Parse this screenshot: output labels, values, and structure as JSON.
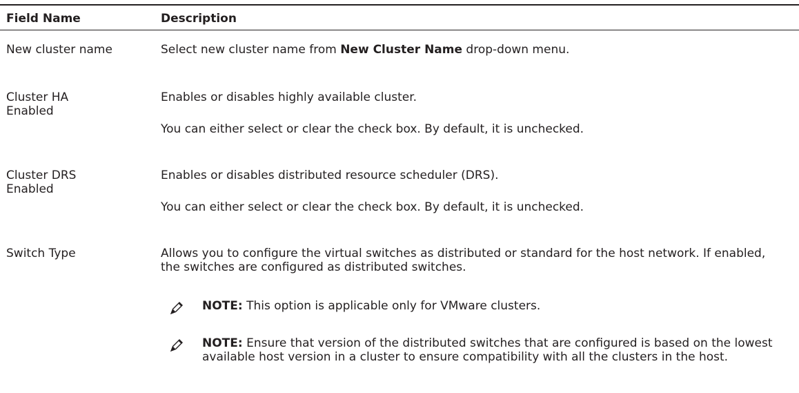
{
  "header": {
    "field_name": "Field Name",
    "description": "Description"
  },
  "rows": [
    {
      "field": "New cluster name",
      "desc_pre": "Select new cluster name from ",
      "desc_bold": "New Cluster Name",
      "desc_post": " drop-down menu."
    },
    {
      "field": "Cluster HA Enabled",
      "desc_p1": "Enables or disables highly available cluster.",
      "desc_p2": "You can either select or clear the check box. By default, it is unchecked."
    },
    {
      "field": "Cluster DRS Enabled",
      "desc_p1": "Enables or disables distributed resource scheduler (DRS).",
      "desc_p2": "You can either select or clear the check box. By default, it is unchecked."
    },
    {
      "field": "Switch Type",
      "desc_p1": "Allows you to configure the virtual switches as distributed or standard for the host network. If enabled, the switches are configured as distributed switches.",
      "notes": [
        {
          "label": "NOTE:",
          "text": " This option is applicable only for VMware clusters."
        },
        {
          "label": "NOTE:",
          "text": " Ensure that version of the distributed switches that are configured is based on the lowest available host version in a cluster to ensure compatibility with all the clusters in the host."
        }
      ]
    }
  ],
  "icons": {
    "note": "note-pencil-icon"
  }
}
